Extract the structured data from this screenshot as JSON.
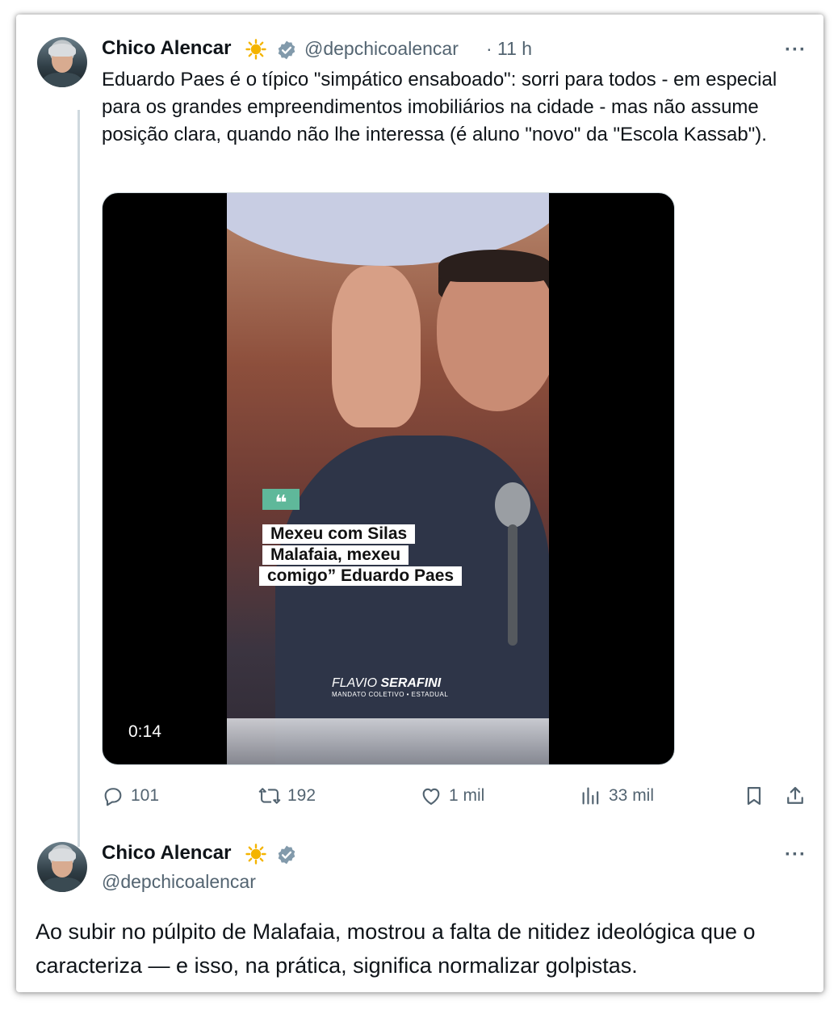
{
  "tweet": {
    "author_name": "Chico Alencar",
    "author_handle": "@depchicoalencar",
    "separator": "·",
    "time": "11 h",
    "more": "···",
    "text": "Eduardo Paes é o típico \"simpático ensaboado\": sorri para todos - em especial para os grandes empreendimentos imobiliários na cidade - mas não assume posição clara, quando não lhe interessa (é aluno \"novo\" da \"Escola Kassab\").",
    "video": {
      "quote_mark": "❝",
      "caption_lines": [
        "Mexeu com Silas",
        "Malafaia, mexeu",
        "comigo” Eduardo Paes"
      ],
      "watermark_line1_a": "FLAVIO ",
      "watermark_line1_b": "SERAFINI",
      "watermark_line2": "MANDATO COLETIVO • ESTADUAL",
      "duration": "0:14"
    },
    "actions": {
      "replies": "101",
      "retweets": "192",
      "likes": "1 mil",
      "views": "33 mil"
    },
    "icons": [
      "reply-icon",
      "retweet-icon",
      "like-icon",
      "views-icon",
      "bookmark-icon",
      "share-icon",
      "verified-icon",
      "sun-emoji"
    ]
  },
  "reply": {
    "author_name": "Chico Alencar",
    "author_handle": "@depchicoalencar",
    "more": "···",
    "text": "Ao subir no púlpito de Malafaia, mostrou a falta de nitidez ideológica que o caracteriza — e isso, na prática, significa normalizar golpistas."
  },
  "colors": {
    "text": "#0f1419",
    "muted": "#536471",
    "sun": "#f4b400",
    "verified": "#829aab",
    "thread_line": "#cfd9de"
  }
}
